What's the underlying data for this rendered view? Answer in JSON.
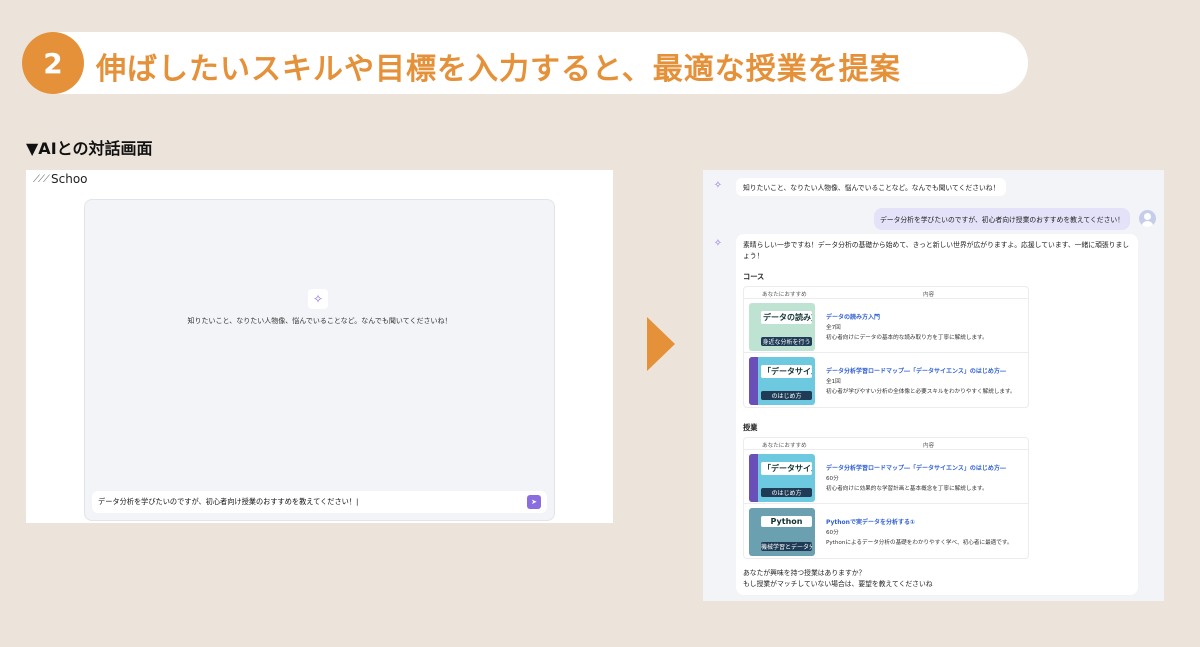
{
  "header": {
    "step_number": "2",
    "title": "伸ばしたいスキルや目標を入力すると、最適な授業を提案",
    "section_label": "▼AIとの対話画面"
  },
  "colors": {
    "accent": "#e5913a",
    "ai_purple": "#8a6ee0",
    "link_blue": "#2f5fd0"
  },
  "left_screen": {
    "app_name": "Schoo",
    "logo_icon": "schoo-logo-icon",
    "ai_icon": "ai-sparkle-icon",
    "greeting": "知りたいこと、なりたい人物像、悩んでいることなど。なんでも聞いてくださいね！",
    "input_value": "データ分析を学びたいのですが、初心者向け授業のおすすめを教えてください！|",
    "send_icon": "send-arrow-icon"
  },
  "right_screen": {
    "ai_greeting": "知りたいこと、なりたい人物像、悩んでいることなど。なんでも聞いてくださいね！",
    "user_message": "データ分析を学びたいのですが、初心者向け授業のおすすめを教えてください！",
    "answer_intro": "素晴らしい一歩ですね！データ分析の基礎から始めて、きっと新しい世界が広がりますよ。応援しています、一緒に頑張りましょう！",
    "courses": {
      "label": "コース",
      "col_recommend": "あなたにおすすめ",
      "col_content": "内容",
      "items": [
        {
          "thumb_title": "データの読み方入門",
          "thumb_sub": "身近な分析を行う",
          "title": "データの読み方入門",
          "meta": "全7回",
          "desc": "初心者向けにデータの基本的な読み取り方を丁寧に解説します。"
        },
        {
          "thumb_title": "「データサイエンス」",
          "thumb_sub": "のはじめ方",
          "title": "データ分析学習ロードマップ―「データサイエンス」のはじめ方―",
          "meta": "全1回",
          "desc": "初心者が学びやすい分析の全体像と必要スキルをわかりやすく解説します。"
        }
      ]
    },
    "lessons": {
      "label": "授業",
      "col_recommend": "あなたにおすすめ",
      "col_content": "内容",
      "items": [
        {
          "thumb_title": "「データサイエンス」",
          "thumb_sub": "のはじめ方",
          "title": "データ分析学習ロードマップ―「データサイエンス」のはじめ方―",
          "meta": "60分",
          "desc": "初心者向けに効果的な学習計画と基本概念を丁寧に解説します。"
        },
        {
          "thumb_title": "Python",
          "thumb_sub": "機械学習とデータ分析",
          "title": "Pythonで実データを分析する①",
          "meta": "60分",
          "desc": "Pythonによるデータ分析の基礎をわかりやすく学べ、初心者に最適です。"
        }
      ]
    },
    "closing_1": "あなたが興味を持つ授業はありますか？",
    "closing_2": "もし授業がマッチしていない場合は、要望を教えてくださいね"
  }
}
